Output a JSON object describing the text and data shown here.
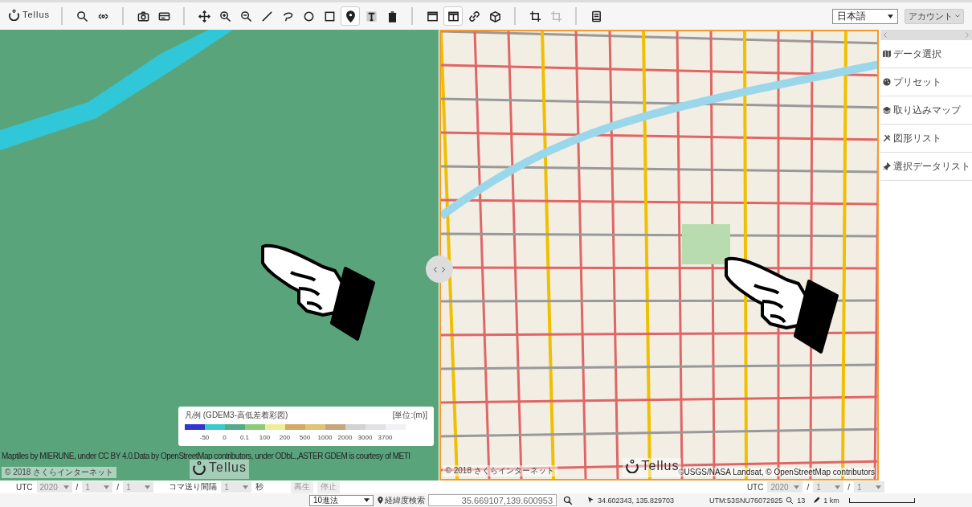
{
  "toolbar": {
    "logo": "Tellus",
    "groups": [
      [
        {
          "kind": "search",
          "selected": false,
          "disabled": false
        },
        {
          "kind": "eye",
          "selected": false,
          "disabled": false
        }
      ],
      [
        {
          "kind": "camera",
          "selected": false,
          "disabled": false
        },
        {
          "kind": "card",
          "selected": false,
          "disabled": false
        }
      ],
      [
        {
          "kind": "move",
          "selected": false,
          "disabled": false
        },
        {
          "kind": "zoom-in",
          "selected": false,
          "disabled": false
        },
        {
          "kind": "zoom-out",
          "selected": false,
          "disabled": false
        },
        {
          "kind": "line",
          "selected": false,
          "disabled": false
        },
        {
          "kind": "lasso",
          "selected": false,
          "disabled": false
        },
        {
          "kind": "circle",
          "selected": false,
          "disabled": false
        },
        {
          "kind": "square",
          "selected": false,
          "disabled": false
        },
        {
          "kind": "pin",
          "selected": true,
          "disabled": false
        },
        {
          "kind": "text",
          "selected": false,
          "disabled": false
        },
        {
          "kind": "trash",
          "selected": false,
          "disabled": false
        }
      ],
      [
        {
          "kind": "window",
          "selected": false,
          "disabled": false
        },
        {
          "kind": "split",
          "selected": true,
          "disabled": false
        },
        {
          "kind": "link",
          "selected": false,
          "disabled": false
        },
        {
          "kind": "cube",
          "selected": false,
          "disabled": false
        }
      ],
      [
        {
          "kind": "crop",
          "selected": false,
          "disabled": false
        },
        {
          "kind": "crop",
          "selected": false,
          "disabled": true
        }
      ],
      [
        {
          "kind": "document",
          "selected": false,
          "disabled": false
        }
      ]
    ],
    "language": "日本語",
    "account": "アカウント"
  },
  "left_map": {
    "legend": {
      "title": "凡例 (GDEM3-高低差着彩図)",
      "unit": "[単位:(m)]",
      "swatches": [
        {
          "color": "#3434d0"
        },
        {
          "color": "#36cccc"
        },
        {
          "color": "#55aa88"
        },
        {
          "color": "#8ccc78"
        },
        {
          "color": "#eeee99"
        },
        {
          "color": "#d4aa66"
        },
        {
          "color": "#ddc477"
        },
        {
          "color": "#c4a67a"
        },
        {
          "color": "#d2d2d2"
        },
        {
          "color": "#e2e2e6"
        },
        {
          "color": "#f2f2f6"
        }
      ],
      "labels": [
        "-50",
        "0",
        "0.1",
        "100",
        "200",
        "500",
        "1000",
        "2000",
        "3000",
        "3700"
      ]
    },
    "attribution": "Maptiles by MIERUNE, under CC BY 4.0.Data by OpenStreetMap contributors, under ODbL.,ASTER GDEM is courtesy of METI",
    "copyright": "© 2018 さくらインターネット",
    "logo": "Tellus"
  },
  "right_map": {
    "attribution": "©USGS/NASA Landsat, © OpenStreetMap contributors",
    "copyright": "© 2018 さくらインターネット",
    "logo": "Tellus"
  },
  "sidebar": {
    "items": [
      {
        "kind": "map",
        "label": "データ選択"
      },
      {
        "kind": "palette",
        "label": "プリセット"
      },
      {
        "kind": "layers",
        "label": "取り込みマップ"
      },
      {
        "kind": "tools",
        "label": "図形リスト"
      },
      {
        "kind": "pin",
        "label": "選択データリスト"
      }
    ]
  },
  "time_bar": {
    "left": {
      "label": "UTC",
      "year": "2020",
      "separator_1": "/",
      "month": "1",
      "separator_2": "/",
      "day": "1"
    },
    "interval_label": "コマ送り間隔",
    "interval": "1",
    "unit": "秒",
    "buttons": [
      {
        "label": "再生",
        "disabled": true
      },
      {
        "label": "停止",
        "disabled": true
      }
    ],
    "right": {
      "label": "UTC",
      "year": "2020",
      "separator_1": "/",
      "month": "1",
      "separator_2": "/",
      "day": "1"
    },
    "disabled": true
  },
  "status_bar": {
    "format": "10進法",
    "search_label": "経緯度検索",
    "search_value": "35.669107,139.600953",
    "cursor": "34.602343, 135.829703",
    "utm": "UTM:53SNU76072925",
    "zoom": "13",
    "scale": "1 km"
  }
}
